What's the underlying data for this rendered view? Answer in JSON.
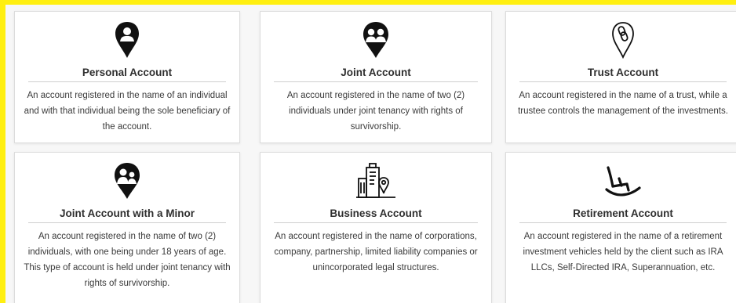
{
  "colors": {
    "frame": "#ffef10",
    "card_border": "#dcdcdc",
    "text": "#2f2f2f"
  },
  "cards": [
    {
      "icon": "personal-pin-icon",
      "title": "Personal Account",
      "description": "An account registered in the name of an individual and with that individual being the sole beneficiary of the account."
    },
    {
      "icon": "joint-pin-icon",
      "title": "Joint Account",
      "description": "An account registered in the name of two (2) individuals under joint tenancy with rights of survivorship."
    },
    {
      "icon": "trust-pin-icon",
      "title": "Trust Account",
      "description": "An account registered in the name of a trust, while a trustee controls the management of the investments."
    },
    {
      "icon": "minor-pin-icon",
      "title": "Joint Account with a Minor",
      "description": "An account registered in the name of two (2) individuals, with one being under 18 years of age. This type of account is held under joint tenancy with rights of survivorship."
    },
    {
      "icon": "business-building-icon",
      "title": "Business Account",
      "description": "An account registered in the name of corporations, company, partnership, limited liability companies or unincorporated legal structures."
    },
    {
      "icon": "rocking-chair-icon",
      "title": "Retirement Account",
      "description": "An account registered in the name of a retirement investment vehicles held by the client such as IRA LLCs, Self-Directed IRA, Superannuation, etc."
    }
  ]
}
